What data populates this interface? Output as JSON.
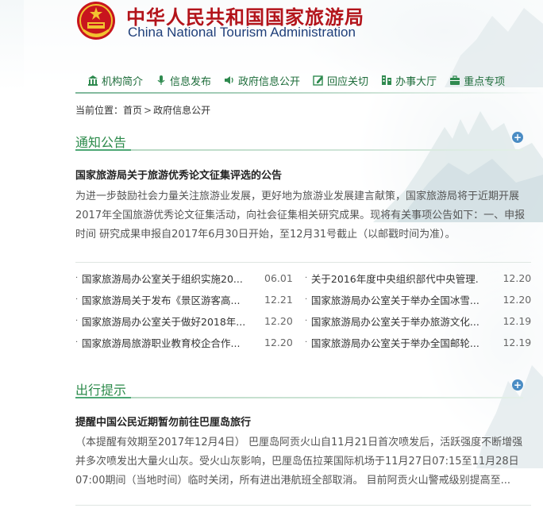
{
  "header": {
    "title_cn": "中华人民共和国国家旅游局",
    "title_en": "China National Tourism Administration"
  },
  "nav": [
    {
      "label": "机构简介",
      "icon": "building-icon"
    },
    {
      "label": "信息发布",
      "icon": "microphone-icon"
    },
    {
      "label": "政府信息公开",
      "icon": "speaker-icon"
    },
    {
      "label": "回应关切",
      "icon": "edit-icon"
    },
    {
      "label": "办事大厅",
      "icon": "hall-icon"
    },
    {
      "label": "重点专项",
      "icon": "briefcase-icon"
    }
  ],
  "breadcrumb": {
    "prefix": "当前位置：",
    "home": "首页",
    "sep": ">",
    "current": "政府信息公开"
  },
  "notice": {
    "section_title": "通知公告",
    "more": "+",
    "headline": "国家旅游局关于旅游优秀论文征集评选的公告",
    "summary": "为进一步鼓励社会力量关注旅游业发展，更好地为旅游业发展建言献策，国家旅游局将于近期开展2017年全国旅游优秀论文征集活动，向社会征集相关研究成果。现将有关事项公告如下：一、申报时间 研究成果申报自2017年6月30日开始，至12月31号截止（以邮戳时间为准）。",
    "items": [
      {
        "title": "国家旅游局办公室关于组织实施20...",
        "date": "06.01"
      },
      {
        "title": "关于2016年度中央组织部代中央管理...",
        "date": "12.20"
      },
      {
        "title": "国家旅游局关于发布《景区游客高...",
        "date": "12.21"
      },
      {
        "title": "国家旅游局办公室关于举办全国冰雪...",
        "date": "12.20"
      },
      {
        "title": "国家旅游局办公室关于做好2018年...",
        "date": "12.20"
      },
      {
        "title": "国家旅游局办公室关于举办旅游文化...",
        "date": "12.19"
      },
      {
        "title": "国家旅游局旅游职业教育校企合作...",
        "date": "12.20"
      },
      {
        "title": "国家旅游局办公室关于举办全国邮轮...",
        "date": "12.19"
      }
    ]
  },
  "travel": {
    "section_title": "出行提示",
    "more": "+",
    "headline": "提醒中国公民近期暂勿前往巴厘岛旅行",
    "summary": "（本提醒有效期至2017年12月4日） 巴厘岛阿贡火山自11月21日首次喷发后，活跃强度不断增强并多次喷发出大量火山灰。受火山灰影响，巴厘岛伍拉莱国际机场于11月27日07:15至11月28日07:00期间（当地时间）临时关闭，所有进出港航班全部取消。 目前阿贡火山警戒级别提高至..."
  },
  "colors": {
    "brand_red": "#b3141b",
    "brand_blue": "#1f3f7a",
    "green": "#2b8a4a",
    "more_blue": "#4a8cc4"
  }
}
